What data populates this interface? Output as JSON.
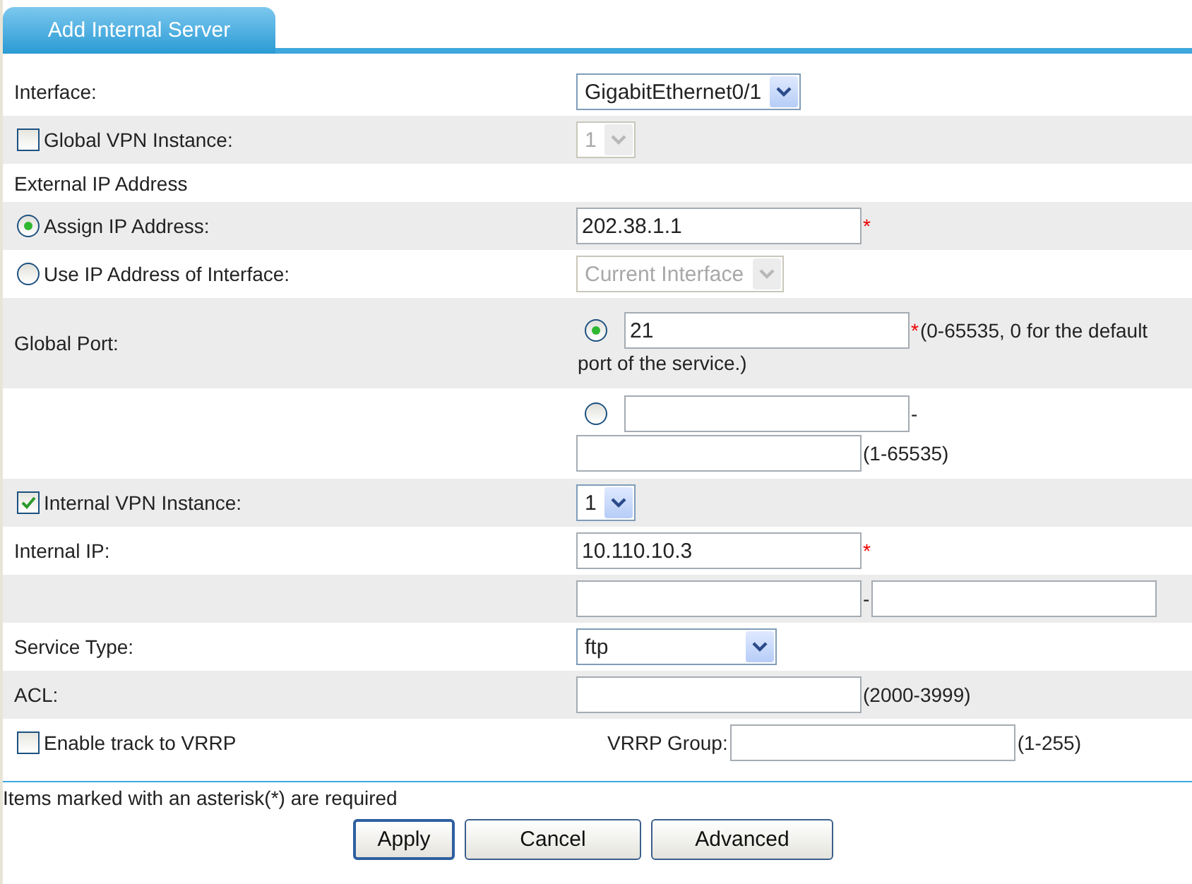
{
  "tab": {
    "label": "Add Internal Server",
    "selected": true
  },
  "rows": [
    {
      "kind": "select",
      "label": "Interface:",
      "select": {
        "value": "GigabitEthernet0/1",
        "disabled": false
      }
    },
    {
      "kind": "check_select",
      "label": "Global VPN Instance:",
      "checked": false,
      "select": {
        "value": "1",
        "disabled": true
      }
    },
    {
      "kind": "heading",
      "label": "External IP Address"
    },
    {
      "kind": "radio_input",
      "label": "Assign IP Address:",
      "selected": true,
      "input": {
        "value": "202.38.1.1"
      },
      "asterisk": "*"
    },
    {
      "kind": "radio_select",
      "label": "Use IP Address of Interface:",
      "selected": false,
      "select": {
        "value": "Current Interface",
        "disabled": true
      }
    },
    {
      "kind": "port_single",
      "label": "Global Port:",
      "selected": true,
      "input": {
        "value": "21"
      },
      "asterisk": "*",
      "hint_lines": [
        "(0-65535, 0 for the default",
        "port of the service.)"
      ]
    },
    {
      "kind": "port_range",
      "selected": false,
      "separator": "-",
      "hint": "(1-65535)"
    },
    {
      "kind": "check_select",
      "label": "Internal VPN Instance:",
      "checked": true,
      "select": {
        "value": "1",
        "disabled": false
      }
    },
    {
      "kind": "input",
      "label": "Internal IP:",
      "input": {
        "value": "10.110.10.3"
      },
      "asterisk": "*"
    },
    {
      "kind": "range",
      "separator": "-"
    },
    {
      "kind": "select",
      "label": "Service Type:",
      "select": {
        "value": "ftp",
        "disabled": false
      }
    },
    {
      "kind": "input",
      "label": "ACL:",
      "hint": "(2000-3999)"
    },
    {
      "kind": "check_group",
      "label": "Enable track to VRRP",
      "checked": false,
      "group_label": "VRRP Group:",
      "hint": "(1-255)"
    }
  ],
  "note": "Items marked with an asterisk(*) are required",
  "buttons": [
    {
      "label": "Apply",
      "default": true
    },
    {
      "label": "Cancel",
      "default": false
    },
    {
      "label": "Advanced",
      "default": false
    }
  ]
}
